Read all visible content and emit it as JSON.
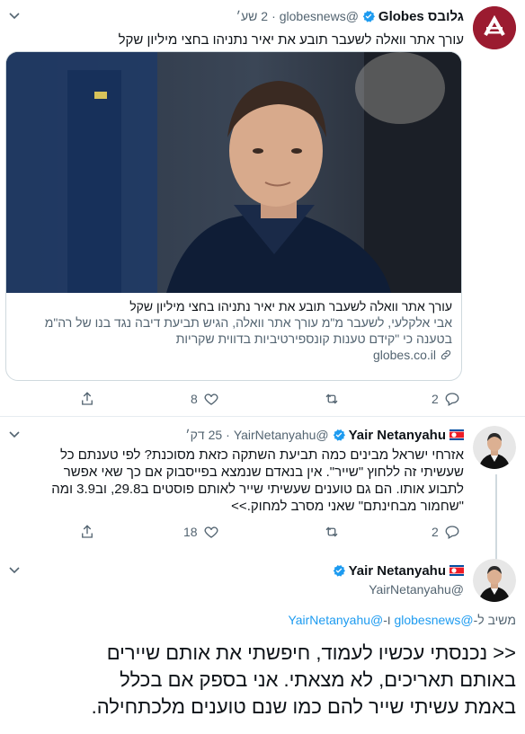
{
  "tweet1": {
    "name": "גלובס Globes",
    "handle": "@globesnews",
    "time": "2 שע׳",
    "text": "עורך אתר וואלה לשעבר תובע את יאיר נתניהו בחצי מיליון שקל",
    "card": {
      "title": "עורך אתר וואלה לשעבר תובע את יאיר נתניהו בחצי מיליון שקל",
      "description": "אבי אלקלעי, לשעבר מ\"מ עורך אתר וואלה, הגיש תביעת דיבה נגד בנו של רה\"מ בטענה כי \"קידם טענות קונספירטיביות בדווית שקריות",
      "domain": "globes.co.il"
    },
    "replies": "2",
    "retweets": "",
    "likes": "8"
  },
  "tweet2": {
    "name": "Yair Netanyahu",
    "handle": "@YairNetanyahu",
    "time": "25 דק׳",
    "line1": "אזרחי ישראל מבינים כמה תביעת השתקה כזאת מסוכנת? לפי טענתם כל",
    "line2": "שעשיתי זה ללחוץ \"שייר\".  אין בנאדם שנמצא בפייסבוק אם כך שאי אפשר",
    "line3": "לתבוע אותו. הם גם טוענים שעשיתי שייר לאותם פוסטים ב29.8, וב3.9 ומה",
    "line4": "\"שחמור מבחינתם\" שאני מסרב למחוק.>>",
    "replies": "2",
    "retweets": "",
    "likes": "18"
  },
  "tweet3": {
    "name": "Yair Netanyahu",
    "handle": "@YairNetanyahu",
    "reply_prefix": "משיב ל-",
    "reply_users": "@globesnews",
    "reply_and": " ו-",
    "reply_users2": "@YairNetanyahu",
    "line1": "<< נכנסתי עכשיו לעמוד, חיפשתי את אותם שיירים",
    "line2": "באותם תאריכים, לא מצאתי. אני בספק אם בכלל",
    "line3": "באמת עשיתי שייר להם כמו שנם טוענים מלכתחילה."
  },
  "colors": {
    "accent": "#1d9bf0",
    "muted": "#536471",
    "globes_red": "#9b1b30"
  },
  "icons": [
    "globes-logo-icon",
    "verified-badge-icon",
    "north-korea-flag-icon",
    "reply-icon",
    "retweet-icon",
    "like-icon",
    "share-icon",
    "link-icon",
    "caret-icon"
  ]
}
